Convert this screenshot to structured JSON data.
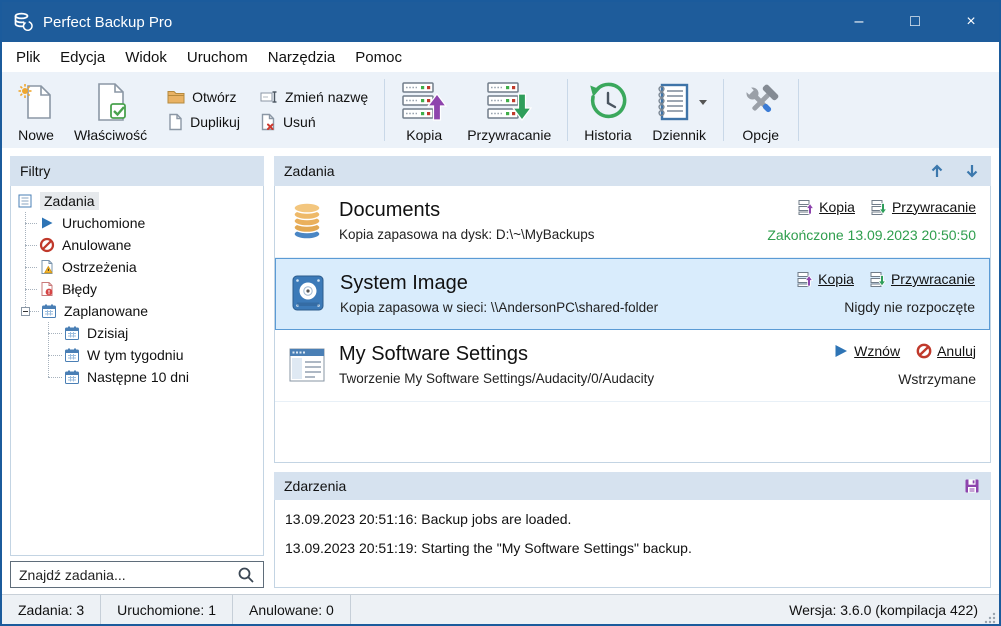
{
  "window": {
    "title": "Perfect Backup Pro",
    "controls": {
      "minimize": "–",
      "maximize": "□",
      "close": "×"
    }
  },
  "menu": {
    "items": [
      "Plik",
      "Edycja",
      "Widok",
      "Uruchom",
      "Narzędzia",
      "Pomoc"
    ]
  },
  "toolbar": {
    "nowe": "Nowe",
    "wlasciwosc": "Właściwość",
    "otworz": "Otwórz",
    "duplikuj": "Duplikuj",
    "zmien_nazwe": "Zmień nazwę",
    "usun": "Usuń",
    "kopia": "Kopia",
    "przywracanie": "Przywracanie",
    "historia": "Historia",
    "dziennik": "Dziennik",
    "opcje": "Opcje"
  },
  "filters": {
    "header": "Filtry",
    "items": [
      "Zadania",
      "Uruchomione",
      "Anulowane",
      "Ostrzeżenia",
      "Błędy",
      "Zaplanowane",
      "Dzisiaj",
      "W tym tygodniu",
      "Następne 10 dni"
    ],
    "search_placeholder": "Znajdź zadania..."
  },
  "tasks": {
    "header": "Zadania",
    "items": [
      {
        "name": "Documents",
        "description": "Kopia zapasowa na dysk: D:\\~\\MyBackups",
        "action1": "Kopia",
        "action2": "Przywracanie",
        "status": "Zakończone 13.09.2023 20:50:50"
      },
      {
        "name": "System Image",
        "description": "Kopia zapasowa w sieci: \\\\AndersonPC\\shared-folder",
        "action1": "Kopia",
        "action2": "Przywracanie",
        "status": "Nigdy nie rozpoczęte"
      },
      {
        "name": "My Software Settings",
        "description": "Tworzenie My Software Settings/Audacity/0/Audacity",
        "action1": "Wznów",
        "action2": "Anuluj",
        "status": "Wstrzymane"
      }
    ]
  },
  "events": {
    "header": "Zdarzenia",
    "lines": [
      "13.09.2023 20:51:16: Backup jobs are loaded.",
      "13.09.2023 20:51:19: Starting the \"My Software Settings\" backup."
    ]
  },
  "statusbar": {
    "tasks": "Zadania: 3",
    "running": "Uruchomione: 1",
    "cancelled": "Anulowane: 0",
    "version": "Wersja: 3.6.0 (kompilacja 422)"
  },
  "colors": {
    "titlebar": "#1e5c9b",
    "accent_green": "#2f9e4d",
    "selection_bg": "#d9ecfc",
    "selection_border": "#5b9bd5"
  }
}
